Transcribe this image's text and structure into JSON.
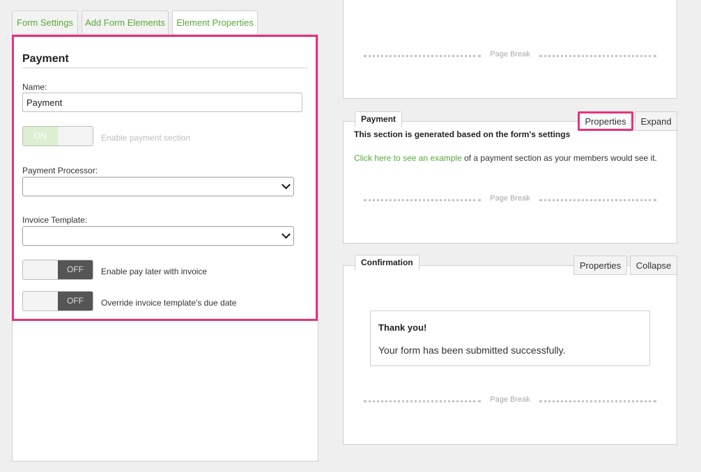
{
  "tabs": [
    {
      "label": "Form Settings"
    },
    {
      "label": "Add Form Elements"
    },
    {
      "label": "Element Properties"
    }
  ],
  "properties": {
    "title": "Payment",
    "name_label": "Name:",
    "name_value": "Payment",
    "enable_toggle": {
      "state": "ON",
      "label": "Enable payment section"
    },
    "processor_label": "Payment Processor:",
    "processor_value": "",
    "invoice_template_label": "Invoice Template:",
    "invoice_template_value": "",
    "pay_later_toggle": {
      "state": "OFF",
      "label": "Enable pay later with invoice"
    },
    "override_toggle": {
      "state": "OFF",
      "label": "Override invoice template's due date"
    }
  },
  "canvas": {
    "page_break_label": "Page Break",
    "payment": {
      "tab_label": "Payment",
      "properties_button": "Properties",
      "expand_button": "Expand",
      "generated_text": "This section is generated based on the form's settings",
      "example_link": "Click here to see an example",
      "example_rest": " of a payment section as your members would see it."
    },
    "confirmation": {
      "tab_label": "Confirmation",
      "properties_button": "Properties",
      "collapse_button": "Collapse",
      "thank_title": "Thank you!",
      "thank_message": "Your form has been submitted successfully."
    }
  },
  "colors": {
    "accent": "#5aa838",
    "highlight": "#e8317a"
  }
}
